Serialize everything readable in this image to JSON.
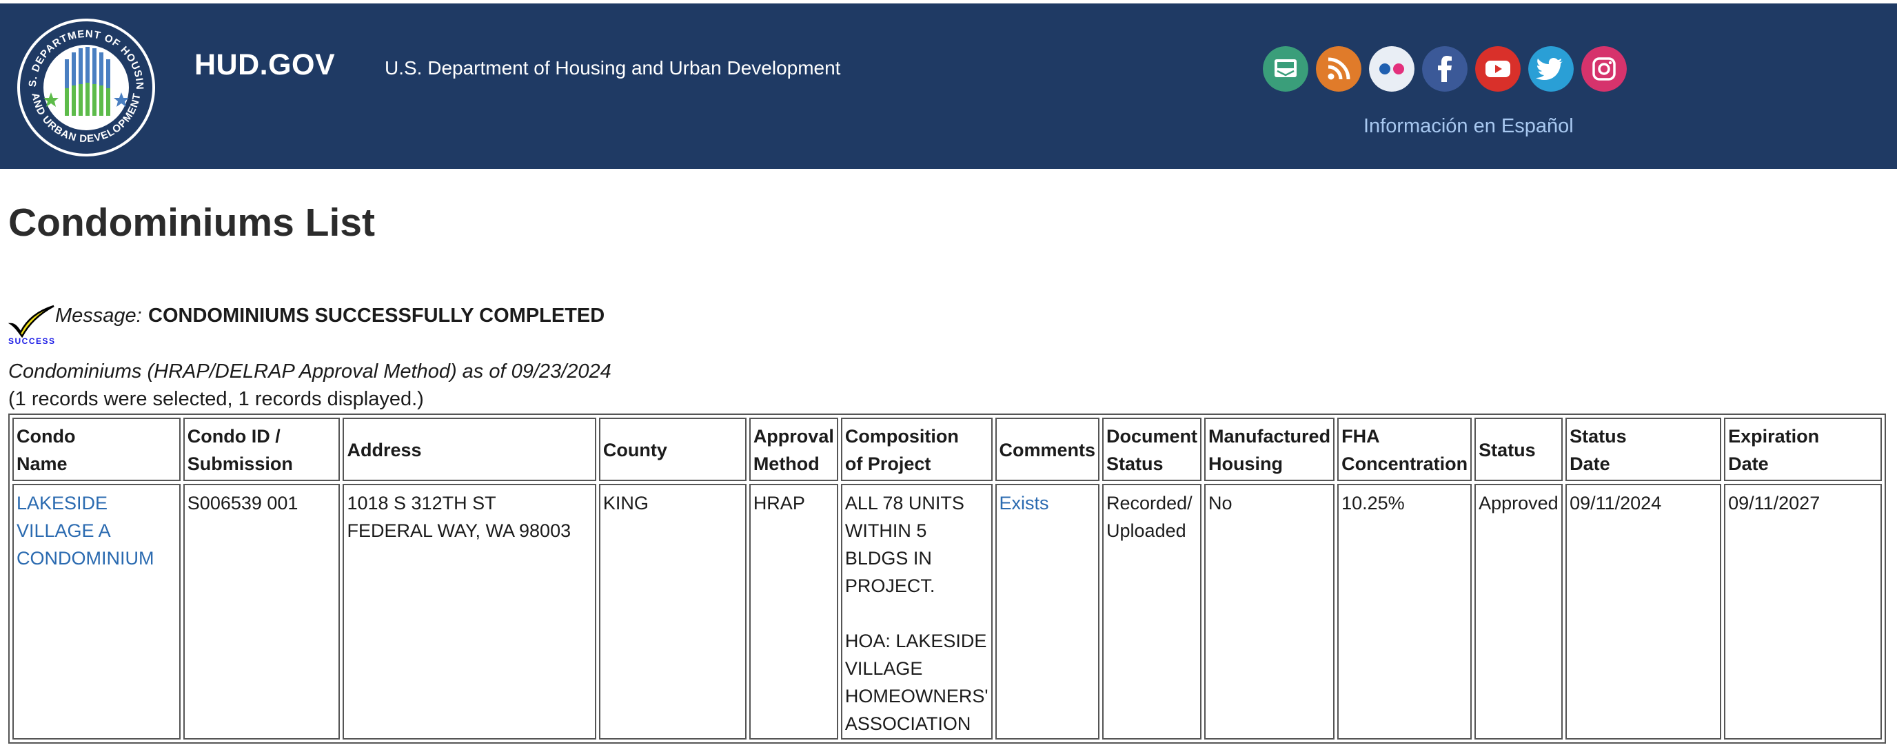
{
  "header": {
    "site_name": "HUD.GOV",
    "agency_name": "U.S. Department of Housing and Urban Development",
    "seal_top_text": "U.S. DEPARTMENT OF HOUSING",
    "seal_bottom_text": "AND URBAN DEVELOPMENT",
    "spanish_link": "Información en Español",
    "background_color": "#1f3a64",
    "social_icons": [
      {
        "name": "email-icon",
        "color": "#3a9e7a"
      },
      {
        "name": "rss-icon",
        "color": "#e07b2a"
      },
      {
        "name": "flickr-icon",
        "color": "#e9eef5"
      },
      {
        "name": "facebook-icon",
        "color": "#3b5998"
      },
      {
        "name": "youtube-icon",
        "color": "#d9302a"
      },
      {
        "name": "twitter-icon",
        "color": "#2a9fd6"
      },
      {
        "name": "instagram-icon",
        "color": "#d6336c"
      }
    ]
  },
  "page": {
    "title": "Condominiums List",
    "message_label": "Message:",
    "message_text": "CONDOMINIUMS SUCCESSFULLY COMPLETED",
    "success_badge": "SUCCESS",
    "as_of": "Condominiums (HRAP/DELRAP Approval Method) as of 09/23/2024",
    "selected_text": "(1 records were selected, 1 records displayed.)"
  },
  "table": {
    "headers": {
      "condo_name": "Condo\nName",
      "condo_id": "Condo ID /\nSubmission",
      "address": "Address",
      "county": "County",
      "approval_method": "Approval\nMethod",
      "composition": "Composition\nof Project",
      "comments": "Comments",
      "document_status": "Document\nStatus",
      "manufactured_housing": "Manufactured\nHousing",
      "fha_concentration": "FHA\nConcentration",
      "status": "Status",
      "status_date": "Status\nDate",
      "expiration_date": "Expiration\nDate"
    },
    "rows": [
      {
        "condo_name": "LAKESIDE VILLAGE A CONDOMINIUM",
        "condo_id": "S006539 001",
        "address": "1018 S 312TH ST\nFEDERAL WAY, WA 98003",
        "county": "KING",
        "approval_method": "HRAP",
        "composition": "ALL 78 UNITS WITHIN 5 BLDGS IN PROJECT.\n\nHOA: LAKESIDE VILLAGE HOMEOWNERS' ASSOCIATION",
        "comments": "Exists",
        "document_status": "Recorded/ Uploaded",
        "manufactured_housing": "No",
        "fha_concentration": "10.25%",
        "status": "Approved",
        "status_date": "09/11/2024",
        "expiration_date": "09/11/2027"
      }
    ]
  }
}
